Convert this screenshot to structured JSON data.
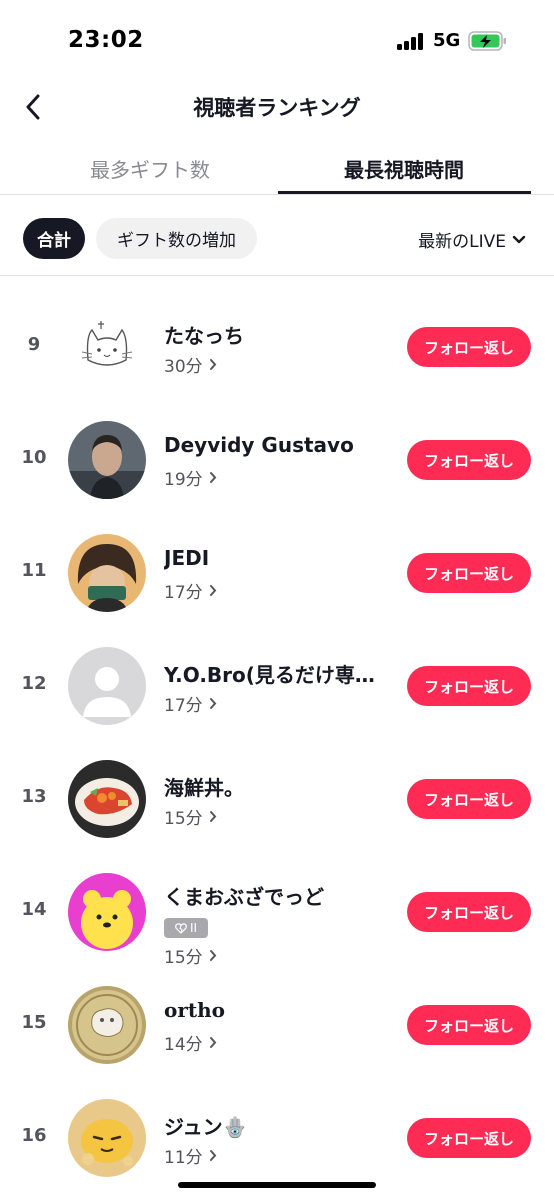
{
  "status_bar": {
    "time": "23:02",
    "network": "5G"
  },
  "nav": {
    "title": "視聴者ランキング"
  },
  "tabs": [
    {
      "label": "最多ギフト数",
      "active": false
    },
    {
      "label": "最長視聴時間",
      "active": true
    }
  ],
  "filters": {
    "chips": [
      {
        "label": "合計",
        "active": true
      },
      {
        "label": "ギフト数の増加",
        "active": false
      }
    ],
    "sort_label": "最新のLIVE"
  },
  "follow_label": "フォロー返し",
  "rows": [
    {
      "rank": "9",
      "name": "たなっち",
      "time": "30分",
      "avatar": "cat-doodle"
    },
    {
      "rank": "10",
      "name": "Deyvidy Gustavo",
      "time": "19分",
      "avatar": "man-portrait"
    },
    {
      "rank": "11",
      "name": "JEDI",
      "time": "17分",
      "avatar": "anime-character"
    },
    {
      "rank": "12",
      "name": "Y.O.Bro(見るだけ専…",
      "time": "17分",
      "avatar": "default-avatar"
    },
    {
      "rank": "13",
      "name": "海鮮丼。",
      "time": "15分",
      "avatar": "seafood-bowl"
    },
    {
      "rank": "14",
      "name": "くまおぶざでっど",
      "time": "15分",
      "badge": "II",
      "avatar": "yellow-bear"
    },
    {
      "rank": "15",
      "name": "ortho",
      "time": "14分",
      "avatar": "coin"
    },
    {
      "rank": "16",
      "name": "ジュン🪬",
      "time": "11分",
      "avatar": "yellow-mascot"
    }
  ],
  "colors": {
    "accent": "#fe2c55",
    "text": "#161823",
    "muted": "#8a8b91"
  }
}
